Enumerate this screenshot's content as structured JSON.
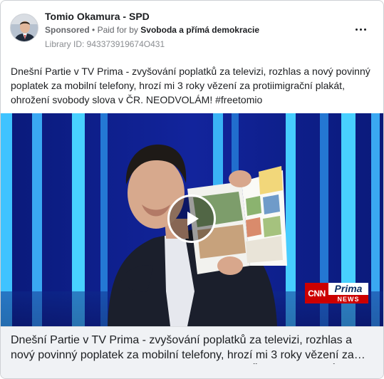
{
  "post": {
    "page_name": "Tomio Okamura - SPD",
    "sponsored_label": "Sponsored",
    "separator": "•",
    "paid_for_by_label": "Paid for by",
    "payer": "Svoboda a přímá demokracie",
    "library_id": "Library ID: 943373919674O431",
    "body_text": "Dnešní Partie v TV Prima - zvyšování poplatků za televizi, rozhlas a nový povinný poplatek za mobilní telefony, hrozí mi 3 roky vězení za protiimigrační plakát, ohrožení svobody slova v ČR. NEODVOLÁM! #freetomio"
  },
  "media": {
    "type": "video",
    "logo_left": "CNN",
    "logo_top": "Prima",
    "logo_bottom": "NEWS"
  },
  "link_preview": {
    "caption": "Dnešní Partie v TV Prima - zvyšování poplatků za televizi, rozhlas a nový povinný poplatek za mobilní telefony, hrozí mi 3 roky vězení za protiimigrační plakát, ohrožení svobody slova v ČR. NEODVOLÁM! #freetomio"
  },
  "icons": {
    "more": "more-options-icon",
    "play": "play-icon",
    "avatar": "avatar"
  },
  "colors": {
    "background": "#ffffff",
    "text_primary": "#1c1e21",
    "text_secondary": "#65676b",
    "caption_bg": "#f0f2f5",
    "studio_blue": "#0a1f8f",
    "cnn_red": "#cc0000"
  }
}
